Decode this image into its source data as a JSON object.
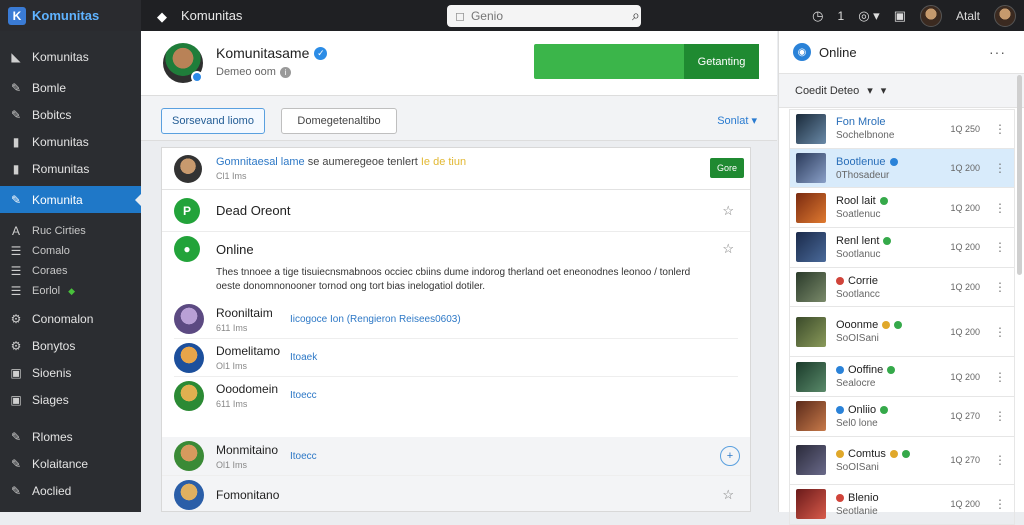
{
  "topbar": {
    "app_name": "Komunitas",
    "page_title": "Komunitas",
    "search_placeholder": "Genio",
    "notif_count": "1",
    "user_name": "Atalt"
  },
  "sidebar": {
    "items": [
      {
        "label": "Komunitas",
        "icon": "home-icon"
      },
      {
        "label": "Bomle",
        "icon": "pin-icon"
      },
      {
        "label": "Bobitcs",
        "icon": "pin-icon"
      },
      {
        "label": "Komunitas",
        "icon": "book-icon"
      },
      {
        "label": "Romunitas",
        "icon": "book-icon"
      },
      {
        "label": "Komunita",
        "icon": "pin-icon",
        "active": true
      }
    ],
    "small_items": [
      {
        "label": "Ruc Cirties",
        "icon": "text-icon"
      },
      {
        "label": "Comalo",
        "icon": "list-icon"
      },
      {
        "label": "Coraes",
        "icon": "list-icon"
      },
      {
        "label": "Eorlol",
        "icon": "list-icon"
      }
    ],
    "bottom_items": [
      {
        "label": "Conomalon",
        "icon": "gear-icon"
      },
      {
        "label": "Bonytos",
        "icon": "gear-icon"
      },
      {
        "label": "Sioenis",
        "icon": "square-icon"
      },
      {
        "label": "Siages",
        "icon": "square-icon"
      },
      {
        "label": "Rlomes",
        "icon": "pin-icon"
      },
      {
        "label": "Kolaitance",
        "icon": "pin-icon"
      },
      {
        "label": "Aoclied",
        "icon": "pin-icon"
      }
    ]
  },
  "profile": {
    "name": "Komunitasame",
    "subtitle": "Demeo oom",
    "cta_label": "Getanting"
  },
  "filters": {
    "primary": "Sorsevand liomo",
    "secondary": "Domegetenaltibo",
    "sort": "Sonlat"
  },
  "feed": {
    "head_link": "Gomnitaesal lame",
    "head_msg": "se aumeregeoe tenlert",
    "head_highlight": "Ie de tiun",
    "head_time": "Cl1 Ims",
    "head_button": "Gore",
    "row1_title": "Dead Oreont",
    "row2_title": "Online",
    "row2_text": "Thes tnnoee a tige tisuiecnsmabnoos occiec cbiins dume indorog therland oet eneonodnes leonoo / tonlerd oeste donomnonooner tornod ong tort bias inelogatiol dotiler.",
    "entries": [
      {
        "name": "Rooniltaim",
        "time": "611 Ims",
        "link": "Iicogoce Ion (Rengieron Reisees0603)"
      },
      {
        "name": "Domelitamo",
        "time": "Ol1 Ims",
        "link": "Itoaek"
      },
      {
        "name": "Ooodomein",
        "time": "611 Ims",
        "link": "Itoecc"
      },
      {
        "name": "Monmitaino",
        "time": "Ol1 Ims",
        "link": "Itoecc"
      },
      {
        "name": "Fomonitano",
        "time": "",
        "link": ""
      }
    ]
  },
  "right_panel": {
    "title": "Online",
    "filter_label": "Coedit Deteo",
    "items": [
      {
        "name": "Fon Mrole",
        "sub": "Sochelbnone",
        "time": "1Q 250",
        "dot": ""
      },
      {
        "name": "Bootlenue",
        "sub": "0Thosadeur",
        "time": "1Q 200",
        "dot": "blue",
        "selected": true
      },
      {
        "name": "Rool lait",
        "sub": "Soatlenuc",
        "time": "1Q 200",
        "dot": "green"
      },
      {
        "name": "Renl lent",
        "sub": "Sootlanuc",
        "time": "1Q 200",
        "dot": "green"
      },
      {
        "name": "Corrie",
        "sub": "Sootlancc",
        "time": "1Q 200",
        "dot": "red"
      },
      {
        "name": "Ooonme",
        "sub": "SoOISani",
        "time": "1Q 200",
        "dot": "yellow"
      },
      {
        "name": "Ooffine",
        "sub": "Sealocre",
        "time": "1Q 200",
        "dot": "blue"
      },
      {
        "name": "Onliio",
        "sub": "Sel0 lone",
        "time": "1Q 270",
        "dot": "green"
      },
      {
        "name": "Comtus",
        "sub": "SoOISani",
        "time": "1Q 270",
        "dot": "yellow"
      },
      {
        "name": "Blenio",
        "sub": "Seotlanie",
        "time": "1Q 200",
        "dot": "red"
      }
    ]
  },
  "colors": {
    "accent": "#1f78c8",
    "green": "#3bb54a",
    "dark": "#1f2023"
  }
}
